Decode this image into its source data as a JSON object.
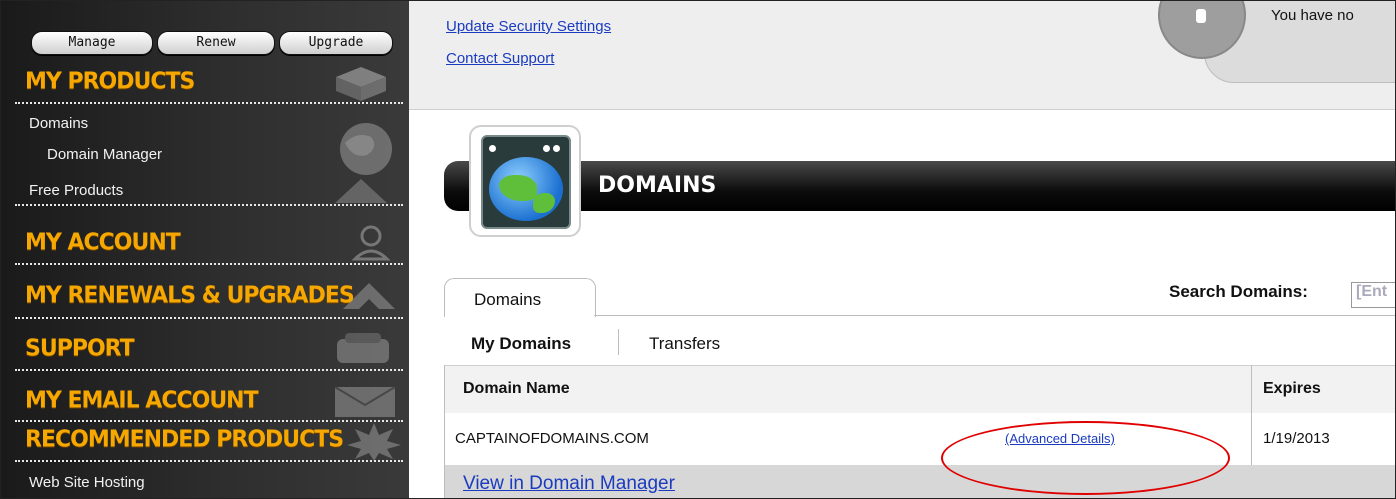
{
  "sidebar": {
    "buttons": [
      "Manage",
      "Renew",
      "Upgrade"
    ],
    "sections": {
      "my_products": "MY PRODUCTS",
      "my_account": "MY ACCOUNT",
      "my_renewals": "MY RENEWALS & UPGRADES",
      "support": "SUPPORT",
      "my_email": "MY EMAIL ACCOUNT",
      "recommended": "RECOMMENDED PRODUCTS"
    },
    "items": {
      "domains": "Domains",
      "domain_manager": "Domain Manager",
      "free_products": "Free Products",
      "web_site_hosting": "Web Site Hosting"
    }
  },
  "top": {
    "links": [
      "Update Security Settings",
      "Contact Support"
    ],
    "alert_text": "You have no"
  },
  "header": {
    "title": "DOMAINS"
  },
  "tabs": {
    "main_tab": "Domains",
    "search_label": "Search Domains:",
    "search_value": "[Ent"
  },
  "subtabs": [
    "My Domains",
    "Transfers"
  ],
  "table": {
    "columns": [
      "Domain Name",
      "Expires"
    ],
    "rows": [
      {
        "domain": "CAPTAINOFDOMAINS.COM",
        "details": "(Advanced Details)",
        "expires": "1/19/2013"
      }
    ],
    "footer_link": "View in Domain Manager"
  },
  "colors": {
    "accent_orange": "#f6a800",
    "link_blue": "#1a3bbf",
    "annotation_red": "#e00000"
  }
}
